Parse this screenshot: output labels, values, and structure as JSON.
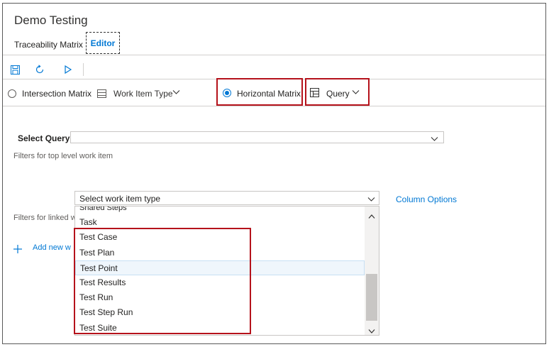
{
  "window": {
    "title": "Demo Testing"
  },
  "tabs": [
    {
      "label": "Traceability Matrix"
    },
    {
      "label": "Editor"
    }
  ],
  "toolbar": {
    "save_icon": "save-icon",
    "refresh_icon": "refresh-icon",
    "run_icon": "play-icon"
  },
  "matrix_options": {
    "intersection_label": "Intersection Matrix",
    "work_item_type_label": "Work Item Type",
    "horizontal_label": "Horizontal Matrix",
    "query_label": "Query"
  },
  "form": {
    "select_query_label": "Select Query",
    "select_query_value": "",
    "filters_top_label": "Filters for top level work item",
    "work_item_type_placeholder": "Select work item type",
    "column_options_label": "Column Options",
    "filters_linked_label": "Filters for linked w",
    "add_new_label": "Add new w"
  },
  "dropdown_list": {
    "partial_item": "Shared Steps",
    "items": [
      "Task",
      "Test Case",
      "Test Plan",
      "Test Point",
      "Test Results",
      "Test Run",
      "Test Step Run",
      "Test Suite"
    ],
    "hovered": "Test Point"
  },
  "colors": {
    "accent": "#0078d4",
    "highlight": "#b5121b"
  }
}
